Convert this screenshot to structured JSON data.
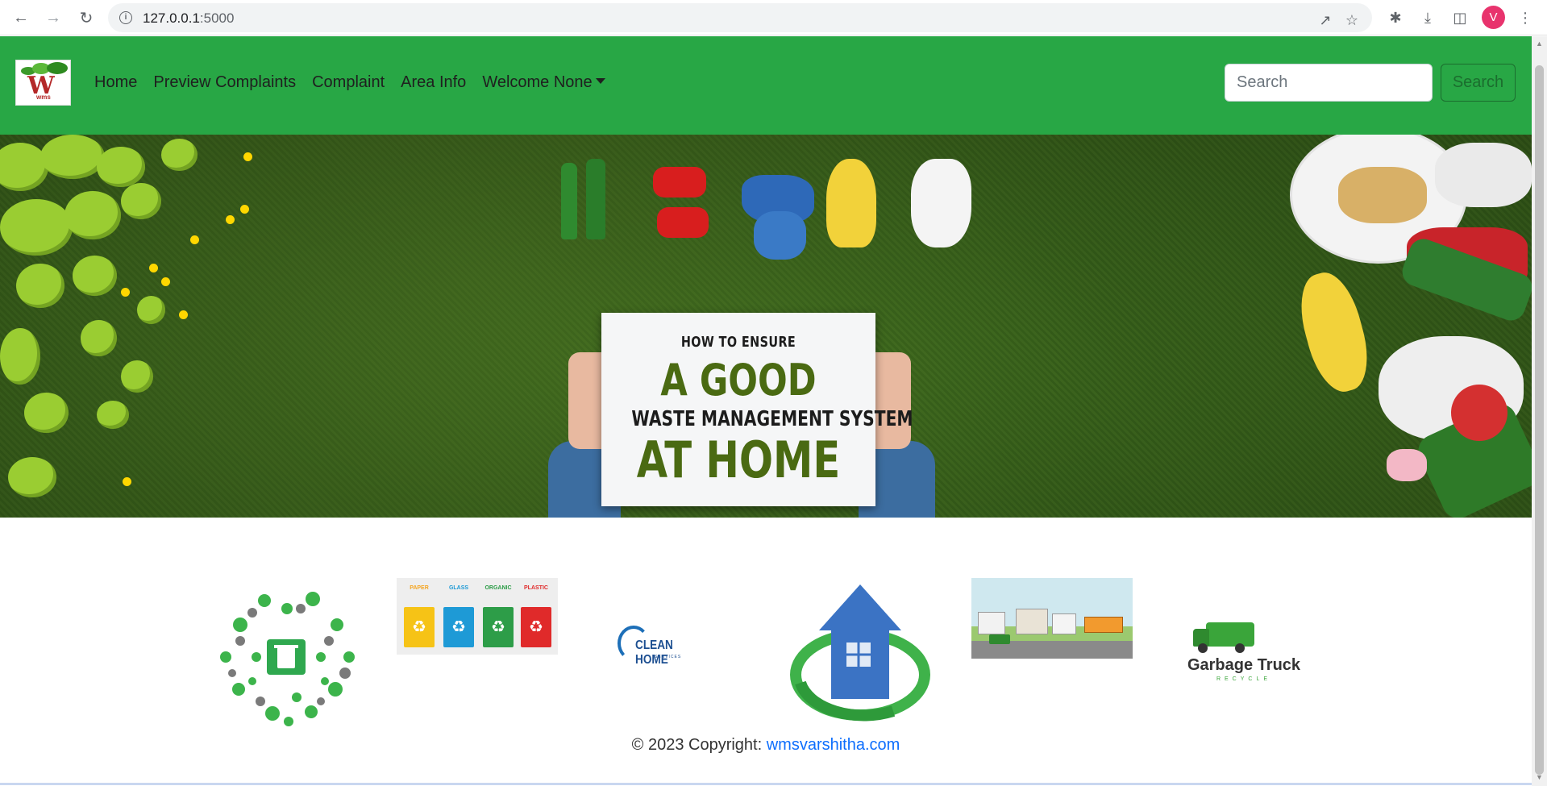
{
  "browser": {
    "url_host": "127.0.0.1",
    "url_port": ":5000",
    "profile_initial": "V",
    "icons": [
      "back-icon",
      "forward-icon",
      "reload-icon",
      "info-icon",
      "share-icon",
      "star-icon",
      "extensions-icon",
      "download-icon",
      "sidepanel-icon",
      "menu-icon"
    ]
  },
  "navbar": {
    "brand_small": "wms",
    "links": [
      "Home",
      "Preview Complaints",
      "Complaint",
      "Area Info",
      "Welcome None"
    ],
    "search_placeholder": "Search",
    "search_button": "Search",
    "bg_color": "#28a745"
  },
  "hero": {
    "sign_line1": "HOW TO ENSURE",
    "sign_line2": "A GOOD",
    "sign_line3": "WASTE MANAGEMENT SYSTEM",
    "sign_line4": "AT HOME"
  },
  "thumbnails": {
    "bins": [
      "PAPER",
      "GLASS",
      "ORGANIC",
      "PLASTIC"
    ],
    "clean_home_title": "CLEAN HOME",
    "clean_home_sub": "SERVICES",
    "truck_title": "Garbage Truck",
    "truck_sub": "RECYCLE"
  },
  "footer": {
    "text": "© 2023 Copyright: ",
    "link": "wmsvarshitha.com"
  }
}
